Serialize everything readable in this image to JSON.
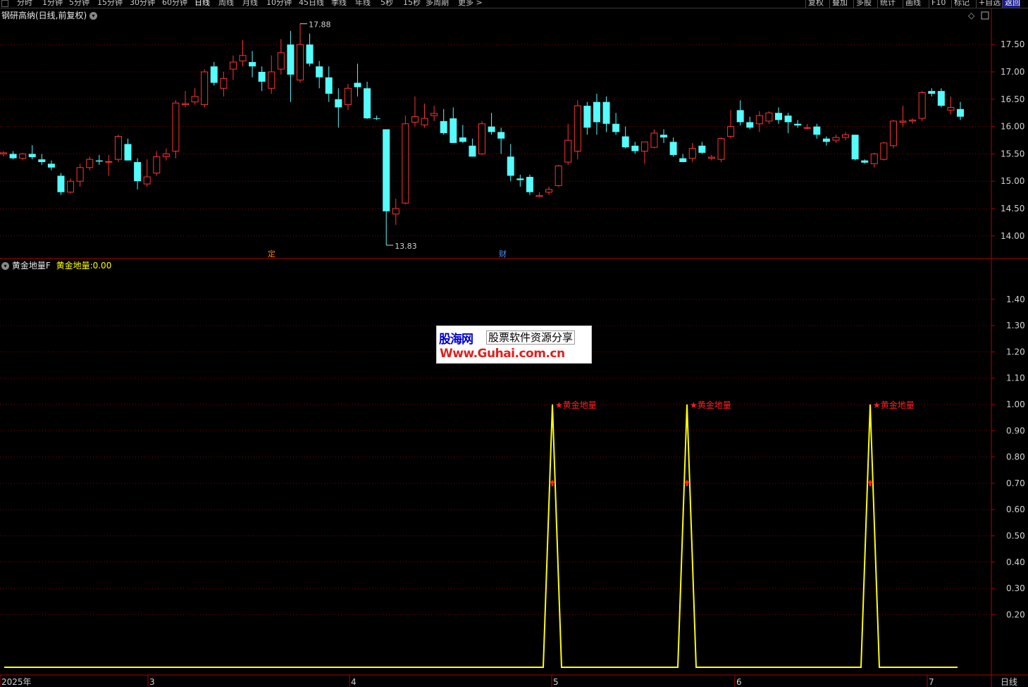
{
  "toolbar": {
    "tabs": [
      "分时",
      "1分钟",
      "5分钟",
      "15分钟",
      "30分钟",
      "60分钟",
      "日线",
      "周线",
      "月线",
      "10分钟",
      "45日线",
      "季线",
      "年线",
      "5秒",
      "15秒",
      "多周期",
      "更多 >"
    ],
    "active_tab": "日线",
    "right_buttons": [
      "复权",
      "叠加",
      "多股",
      "统计",
      "画线",
      "F10",
      "标记",
      "+自选",
      "返回"
    ]
  },
  "main_panel": {
    "title": "钢研高纳(日线,前复权)",
    "high_label": "17.88",
    "low_label": "13.83",
    "event_marks": [
      "定",
      "财"
    ],
    "price_axis": [
      "17.50",
      "17.00",
      "16.50",
      "16.00",
      "15.50",
      "15.00",
      "14.50",
      "14.00"
    ]
  },
  "indicator_panel": {
    "name": "黄金地量F",
    "series_label": "黄金地量:",
    "series_value": "0.00",
    "signal_label": "★黄金地量",
    "axis": [
      "1.40",
      "1.30",
      "1.20",
      "1.10",
      "1.00",
      "0.90",
      "0.80",
      "0.70",
      "0.60",
      "0.50",
      "0.40",
      "0.30",
      "0.20"
    ]
  },
  "x_axis": {
    "labels": [
      "2025年",
      "3",
      "4",
      "5",
      "6",
      "7"
    ],
    "period": "日线"
  },
  "watermark": {
    "logo": "股海网",
    "slogan": "股票软件资源分享",
    "url": "Www.Guhai.com.cn"
  },
  "colors": {
    "up": "#ff3232",
    "down": "#54fcfc",
    "indicator": "#ffff00",
    "signal": "#ff2020",
    "grid": "#8b0000",
    "frame": "#b00000"
  },
  "chart_data": [
    {
      "type": "candlestick",
      "title": "钢研高纳(日线,前复权)",
      "y_ticks": [
        14.0,
        14.5,
        15.0,
        15.5,
        16.0,
        16.5,
        17.0,
        17.5
      ],
      "ylim": [
        13.6,
        18.0
      ],
      "high": 17.88,
      "low": 13.83,
      "candles_ohlc": [
        [
          15.5,
          15.55,
          15.45,
          15.52
        ],
        [
          15.5,
          15.55,
          15.4,
          15.42
        ],
        [
          15.42,
          15.52,
          15.38,
          15.5
        ],
        [
          15.5,
          15.66,
          15.4,
          15.44
        ],
        [
          15.4,
          15.5,
          15.3,
          15.35
        ],
        [
          15.32,
          15.38,
          15.2,
          15.25
        ],
        [
          15.1,
          15.15,
          14.75,
          14.8
        ],
        [
          14.8,
          15.05,
          14.78,
          15.0
        ],
        [
          15.0,
          15.32,
          14.9,
          15.25
        ],
        [
          15.25,
          15.45,
          15.2,
          15.4
        ],
        [
          15.38,
          15.48,
          15.3,
          15.36
        ],
        [
          15.35,
          15.48,
          15.1,
          15.36
        ],
        [
          15.4,
          15.85,
          15.35,
          15.82
        ],
        [
          15.68,
          15.78,
          15.38,
          15.38
        ],
        [
          15.35,
          15.42,
          14.85,
          15.0
        ],
        [
          14.95,
          15.4,
          14.9,
          15.08
        ],
        [
          15.15,
          15.55,
          15.1,
          15.45
        ],
        [
          15.45,
          15.6,
          15.38,
          15.5
        ],
        [
          15.55,
          16.48,
          15.42,
          16.43
        ],
        [
          16.4,
          16.65,
          16.35,
          16.42
        ],
        [
          16.45,
          16.7,
          16.4,
          16.55
        ],
        [
          16.4,
          17.05,
          16.35,
          17.0
        ],
        [
          17.1,
          17.18,
          16.75,
          16.8
        ],
        [
          16.7,
          17.0,
          16.55,
          16.88
        ],
        [
          17.05,
          17.3,
          16.85,
          17.18
        ],
        [
          17.2,
          17.58,
          17.1,
          17.3
        ],
        [
          17.18,
          17.38,
          16.9,
          17.1
        ],
        [
          17.0,
          17.1,
          16.65,
          16.82
        ],
        [
          16.7,
          17.3,
          16.6,
          17.0
        ],
        [
          17.05,
          17.6,
          16.95,
          17.35
        ],
        [
          17.5,
          17.75,
          16.45,
          16.95
        ],
        [
          16.85,
          17.88,
          16.8,
          17.5
        ],
        [
          17.5,
          17.7,
          17.1,
          17.15
        ],
        [
          17.1,
          17.2,
          16.7,
          16.9
        ],
        [
          16.9,
          17.1,
          16.45,
          16.6
        ],
        [
          16.5,
          16.7,
          15.98,
          16.35
        ],
        [
          16.4,
          16.78,
          16.3,
          16.7
        ],
        [
          16.8,
          17.15,
          16.55,
          16.72
        ],
        [
          16.7,
          16.82,
          16.14,
          16.15
        ],
        [
          16.15,
          16.2,
          16.12,
          16.14
        ],
        [
          15.95,
          15.95,
          13.83,
          14.45
        ],
        [
          14.4,
          14.68,
          14.2,
          14.5
        ],
        [
          14.6,
          16.2,
          14.58,
          16.05
        ],
        [
          16.08,
          16.55,
          16.0,
          16.18
        ],
        [
          16.03,
          16.42,
          15.98,
          16.15
        ],
        [
          16.2,
          16.38,
          16.1,
          16.24
        ],
        [
          16.1,
          16.32,
          15.85,
          15.88
        ],
        [
          16.15,
          16.35,
          15.7,
          15.7
        ],
        [
          15.8,
          16.03,
          15.7,
          15.72
        ],
        [
          15.65,
          15.78,
          15.45,
          15.45
        ],
        [
          15.5,
          16.1,
          15.48,
          16.05
        ],
        [
          16.0,
          16.25,
          15.85,
          15.9
        ],
        [
          15.9,
          15.98,
          15.5,
          15.78
        ],
        [
          15.45,
          15.68,
          15.0,
          15.1
        ],
        [
          15.05,
          15.12,
          14.9,
          15.02
        ],
        [
          15.08,
          15.12,
          14.75,
          14.8
        ],
        [
          14.72,
          14.8,
          14.7,
          14.74
        ],
        [
          14.8,
          14.9,
          14.75,
          14.85
        ],
        [
          14.92,
          15.3,
          14.9,
          15.28
        ],
        [
          15.35,
          16.05,
          15.3,
          15.75
        ],
        [
          15.55,
          16.48,
          15.4,
          16.38
        ],
        [
          16.38,
          16.45,
          15.85,
          15.98
        ],
        [
          16.45,
          16.6,
          15.85,
          16.08
        ],
        [
          16.45,
          16.55,
          15.9,
          16.05
        ],
        [
          16.05,
          16.25,
          15.85,
          15.9
        ],
        [
          15.82,
          16.0,
          15.6,
          15.62
        ],
        [
          15.65,
          15.72,
          15.5,
          15.55
        ],
        [
          15.55,
          15.72,
          15.32,
          15.72
        ],
        [
          15.62,
          15.95,
          15.6,
          15.88
        ],
        [
          15.85,
          15.95,
          15.7,
          15.8
        ],
        [
          15.72,
          15.8,
          15.45,
          15.48
        ],
        [
          15.42,
          15.5,
          15.35,
          15.35
        ],
        [
          15.42,
          15.7,
          15.35,
          15.6
        ],
        [
          15.65,
          15.72,
          15.5,
          15.52
        ],
        [
          15.42,
          15.48,
          15.38,
          15.44
        ],
        [
          15.4,
          15.8,
          15.35,
          15.78
        ],
        [
          15.82,
          16.3,
          15.78,
          16.0
        ],
        [
          16.3,
          16.48,
          16.02,
          16.08
        ],
        [
          16.08,
          16.18,
          15.95,
          15.98
        ],
        [
          16.05,
          16.28,
          15.9,
          16.2
        ],
        [
          16.1,
          16.28,
          16.05,
          16.25
        ],
        [
          16.25,
          16.35,
          16.05,
          16.12
        ],
        [
          16.2,
          16.25,
          15.88,
          16.08
        ],
        [
          16.05,
          16.12,
          15.98,
          16.02
        ],
        [
          15.98,
          16.05,
          15.95,
          15.98
        ],
        [
          16.0,
          16.05,
          15.78,
          15.85
        ],
        [
          15.78,
          15.82,
          15.65,
          15.72
        ],
        [
          15.75,
          15.85,
          15.7,
          15.8
        ],
        [
          15.8,
          15.9,
          15.75,
          15.85
        ],
        [
          15.85,
          15.85,
          15.38,
          15.4
        ],
        [
          15.38,
          15.4,
          15.32,
          15.34
        ],
        [
          15.32,
          15.52,
          15.25,
          15.5
        ],
        [
          15.4,
          15.72,
          15.38,
          15.7
        ],
        [
          15.65,
          16.12,
          15.6,
          16.1
        ],
        [
          16.08,
          16.38,
          16.0,
          16.1
        ],
        [
          16.1,
          16.15,
          16.05,
          16.12
        ],
        [
          16.15,
          16.65,
          16.1,
          16.62
        ],
        [
          16.65,
          16.7,
          16.55,
          16.6
        ],
        [
          16.65,
          16.7,
          16.35,
          16.38
        ],
        [
          16.3,
          16.55,
          16.22,
          16.35
        ],
        [
          16.32,
          16.45,
          16.12,
          16.18
        ]
      ]
    },
    {
      "type": "line",
      "name": "黄金地量",
      "ylim": [
        0.0,
        1.5
      ],
      "baseline": 0.0,
      "signals": [
        {
          "date_label_near": "5",
          "value": 1.0
        },
        {
          "date_label_near": "6",
          "value": 1.0
        },
        {
          "date_label_near": "7",
          "value": 1.0
        }
      ]
    }
  ]
}
